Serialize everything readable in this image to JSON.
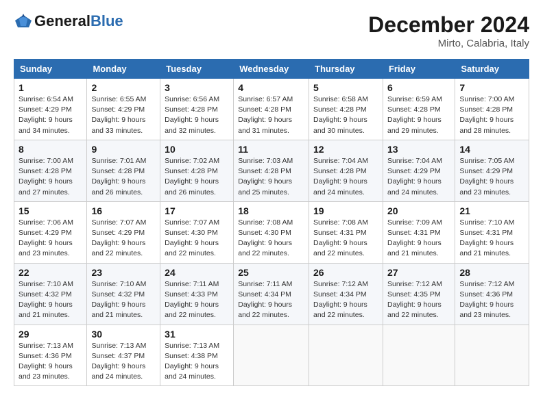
{
  "header": {
    "logo_text_general": "General",
    "logo_text_blue": "Blue",
    "month_title": "December 2024",
    "location": "Mirto, Calabria, Italy"
  },
  "weekdays": [
    "Sunday",
    "Monday",
    "Tuesday",
    "Wednesday",
    "Thursday",
    "Friday",
    "Saturday"
  ],
  "weeks": [
    [
      {
        "day": "1",
        "sunrise": "6:54 AM",
        "sunset": "4:29 PM",
        "daylight": "9 hours and 34 minutes."
      },
      {
        "day": "2",
        "sunrise": "6:55 AM",
        "sunset": "4:29 PM",
        "daylight": "9 hours and 33 minutes."
      },
      {
        "day": "3",
        "sunrise": "6:56 AM",
        "sunset": "4:28 PM",
        "daylight": "9 hours and 32 minutes."
      },
      {
        "day": "4",
        "sunrise": "6:57 AM",
        "sunset": "4:28 PM",
        "daylight": "9 hours and 31 minutes."
      },
      {
        "day": "5",
        "sunrise": "6:58 AM",
        "sunset": "4:28 PM",
        "daylight": "9 hours and 30 minutes."
      },
      {
        "day": "6",
        "sunrise": "6:59 AM",
        "sunset": "4:28 PM",
        "daylight": "9 hours and 29 minutes."
      },
      {
        "day": "7",
        "sunrise": "7:00 AM",
        "sunset": "4:28 PM",
        "daylight": "9 hours and 28 minutes."
      }
    ],
    [
      {
        "day": "8",
        "sunrise": "7:00 AM",
        "sunset": "4:28 PM",
        "daylight": "9 hours and 27 minutes."
      },
      {
        "day": "9",
        "sunrise": "7:01 AM",
        "sunset": "4:28 PM",
        "daylight": "9 hours and 26 minutes."
      },
      {
        "day": "10",
        "sunrise": "7:02 AM",
        "sunset": "4:28 PM",
        "daylight": "9 hours and 26 minutes."
      },
      {
        "day": "11",
        "sunrise": "7:03 AM",
        "sunset": "4:28 PM",
        "daylight": "9 hours and 25 minutes."
      },
      {
        "day": "12",
        "sunrise": "7:04 AM",
        "sunset": "4:28 PM",
        "daylight": "9 hours and 24 minutes."
      },
      {
        "day": "13",
        "sunrise": "7:04 AM",
        "sunset": "4:29 PM",
        "daylight": "9 hours and 24 minutes."
      },
      {
        "day": "14",
        "sunrise": "7:05 AM",
        "sunset": "4:29 PM",
        "daylight": "9 hours and 23 minutes."
      }
    ],
    [
      {
        "day": "15",
        "sunrise": "7:06 AM",
        "sunset": "4:29 PM",
        "daylight": "9 hours and 23 minutes."
      },
      {
        "day": "16",
        "sunrise": "7:07 AM",
        "sunset": "4:29 PM",
        "daylight": "9 hours and 22 minutes."
      },
      {
        "day": "17",
        "sunrise": "7:07 AM",
        "sunset": "4:30 PM",
        "daylight": "9 hours and 22 minutes."
      },
      {
        "day": "18",
        "sunrise": "7:08 AM",
        "sunset": "4:30 PM",
        "daylight": "9 hours and 22 minutes."
      },
      {
        "day": "19",
        "sunrise": "7:08 AM",
        "sunset": "4:31 PM",
        "daylight": "9 hours and 22 minutes."
      },
      {
        "day": "20",
        "sunrise": "7:09 AM",
        "sunset": "4:31 PM",
        "daylight": "9 hours and 21 minutes."
      },
      {
        "day": "21",
        "sunrise": "7:10 AM",
        "sunset": "4:31 PM",
        "daylight": "9 hours and 21 minutes."
      }
    ],
    [
      {
        "day": "22",
        "sunrise": "7:10 AM",
        "sunset": "4:32 PM",
        "daylight": "9 hours and 21 minutes."
      },
      {
        "day": "23",
        "sunrise": "7:10 AM",
        "sunset": "4:32 PM",
        "daylight": "9 hours and 21 minutes."
      },
      {
        "day": "24",
        "sunrise": "7:11 AM",
        "sunset": "4:33 PM",
        "daylight": "9 hours and 22 minutes."
      },
      {
        "day": "25",
        "sunrise": "7:11 AM",
        "sunset": "4:34 PM",
        "daylight": "9 hours and 22 minutes."
      },
      {
        "day": "26",
        "sunrise": "7:12 AM",
        "sunset": "4:34 PM",
        "daylight": "9 hours and 22 minutes."
      },
      {
        "day": "27",
        "sunrise": "7:12 AM",
        "sunset": "4:35 PM",
        "daylight": "9 hours and 22 minutes."
      },
      {
        "day": "28",
        "sunrise": "7:12 AM",
        "sunset": "4:36 PM",
        "daylight": "9 hours and 23 minutes."
      }
    ],
    [
      {
        "day": "29",
        "sunrise": "7:13 AM",
        "sunset": "4:36 PM",
        "daylight": "9 hours and 23 minutes."
      },
      {
        "day": "30",
        "sunrise": "7:13 AM",
        "sunset": "4:37 PM",
        "daylight": "9 hours and 24 minutes."
      },
      {
        "day": "31",
        "sunrise": "7:13 AM",
        "sunset": "4:38 PM",
        "daylight": "9 hours and 24 minutes."
      },
      null,
      null,
      null,
      null
    ]
  ]
}
